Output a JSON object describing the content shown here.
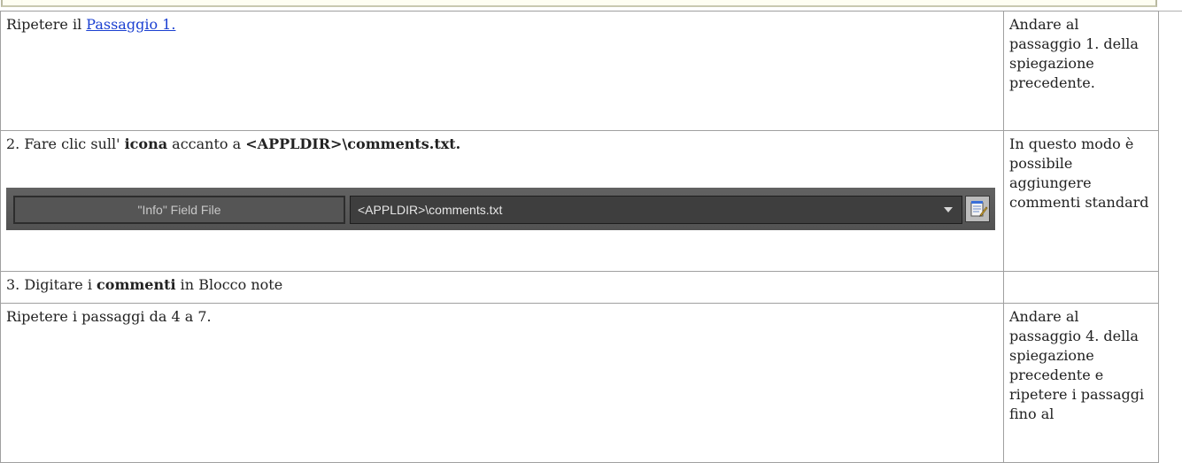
{
  "rows": [
    {
      "step_prefix": "Ripetere il ",
      "step_link": "Passaggio 1.",
      "note": "Andare al passaggio 1. della spiegazione precedente."
    },
    {
      "step_prefix": "2. Fare clic sull' ",
      "step_bold1": "icona",
      "step_mid": " accanto a ",
      "step_bold2": "<APPLDIR>\\comments.txt.",
      "note": "In questo modo è possibile aggiungere commenti standard",
      "ui": {
        "field_label": "\"Info\" Field File",
        "field_value": "<APPLDIR>\\comments.txt",
        "dropdown_icon": "chevron-down-icon",
        "button_icon": "notepad-edit-icon"
      }
    },
    {
      "step_prefix": "3. Digitare i ",
      "step_bold1": "commenti",
      "step_suffix": " in Blocco note",
      "note": ""
    },
    {
      "step_text": "Ripetere i passaggi da 4 a 7.",
      "note": "Andare al passaggio 4. della spiegazione precedente e ripetere i passaggi fino al"
    }
  ]
}
